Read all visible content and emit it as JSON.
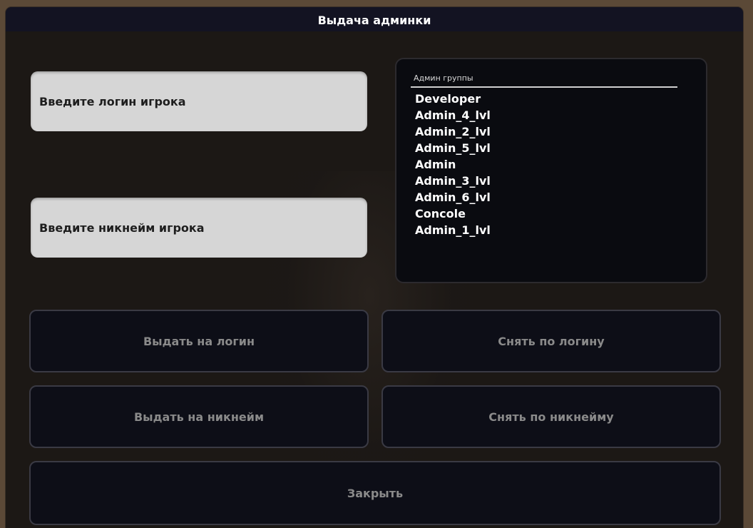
{
  "window": {
    "title": "Выдача админки"
  },
  "form": {
    "login_placeholder": "Введите логин игрока",
    "nickname_placeholder": "Введите никнейм игрока"
  },
  "groups": {
    "title": "Админ группы",
    "items": [
      "Developer",
      "Admin_4_lvl",
      "Admin_2_lvl",
      "Admin_5_lvl",
      "Admin",
      "Admin_3_lvl",
      "Admin_6_lvl",
      "Concole",
      "Admin_1_lvl"
    ]
  },
  "buttons": {
    "give_login": "Выдать на логин",
    "take_login": "Снять по логину",
    "give_nickname": "Выдать на никнейм",
    "take_nickname": "Снять по никнейму",
    "close": "Закрыть"
  },
  "colors": {
    "outer_background": "#5b4937",
    "titlebar": "#131322",
    "panel": "#1c1815",
    "input_fill": "#d6d6d6",
    "button_fill": "#0d0e17",
    "button_text": "#8a8a8a"
  }
}
